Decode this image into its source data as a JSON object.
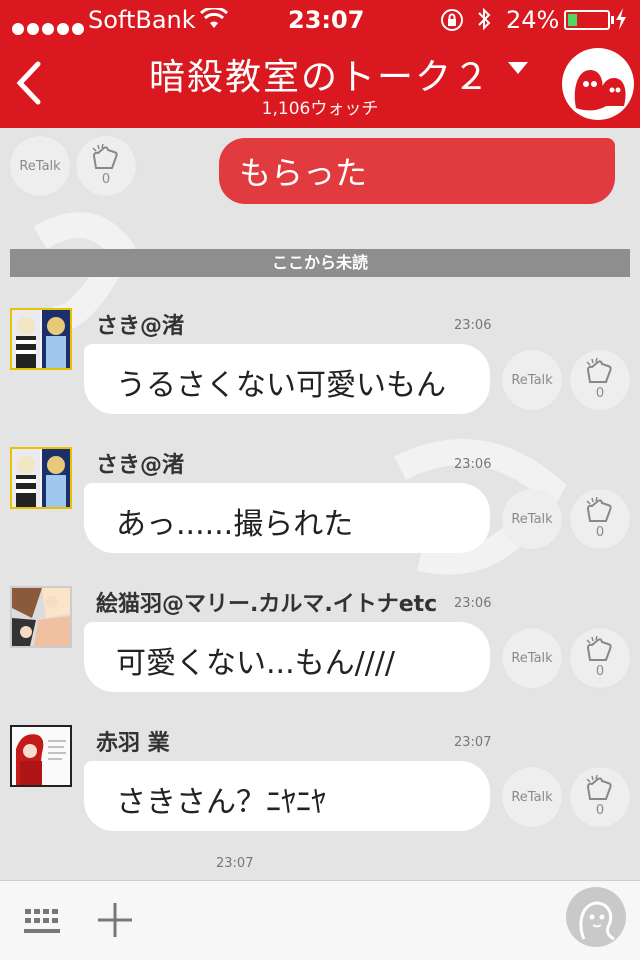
{
  "status_bar": {
    "carrier": "SoftBank",
    "time": "23:07",
    "battery": "24%",
    "battery_level": 0.24
  },
  "header": {
    "title": "暗殺教室のトーク２",
    "watch_count": "1,106ウォッチ"
  },
  "my_message": {
    "text": "もらった",
    "retalk_label": "ReTalk",
    "clap_count": "0"
  },
  "unread_label": "ここから未読",
  "messages": [
    {
      "name": "さき@渚",
      "time": "23:06",
      "text": "うるさくない可愛いもん",
      "retalk_label": "ReTalk",
      "clap_count": "0"
    },
    {
      "name": "さき@渚",
      "time": "23:06",
      "text": "あっ......撮られた",
      "retalk_label": "ReTalk",
      "clap_count": "0"
    },
    {
      "name": "絵猫羽@マリー.カルマ.イトナetc",
      "time": "23:06",
      "text": "可愛くない...もん////",
      "retalk_label": "ReTalk",
      "clap_count": "0"
    },
    {
      "name": "赤羽 業",
      "time": "23:07",
      "text": "さきさん？ﾆﾔﾆﾔ",
      "retalk_label": "ReTalk",
      "clap_count": "0"
    }
  ],
  "bottom_time": "23:07",
  "colors": {
    "brand_red": "#d9191f",
    "my_bubble": "#e23b3f",
    "unread_bar": "#8e8e8e"
  },
  "icons": {
    "back": "back-chevron-icon",
    "dropdown": "chevron-down-icon",
    "wifi": "wifi-icon",
    "lock": "rotation-lock-icon",
    "bluetooth": "bluetooth-icon",
    "clap": "clap-icon",
    "keyboard": "keyboard-icon",
    "plus": "plus-icon",
    "mic": "voice-icon"
  }
}
